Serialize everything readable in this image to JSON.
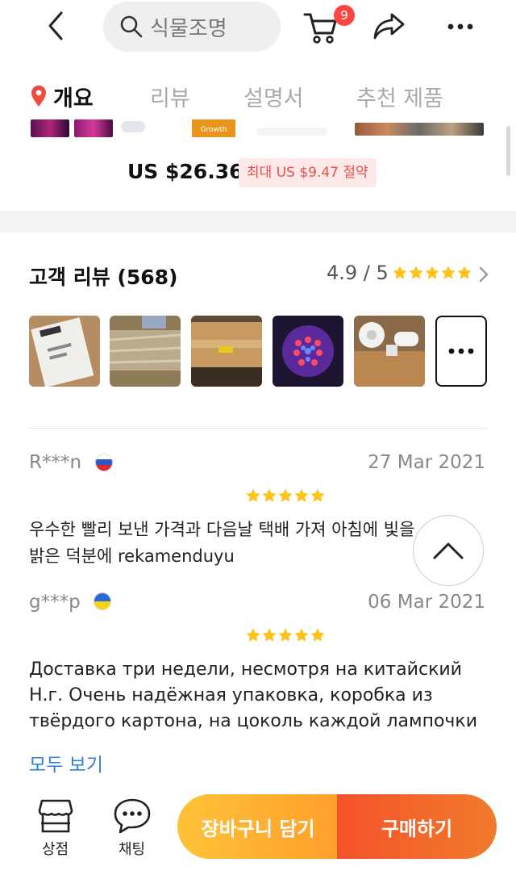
{
  "header": {
    "search_placeholder": "식물조명",
    "cart_count": "9"
  },
  "tabs": [
    {
      "label": "개요",
      "active": true
    },
    {
      "label": "리뷰"
    },
    {
      "label": "설명서"
    },
    {
      "label": "추천 제품"
    }
  ],
  "product": {
    "strip_badge": "Growth",
    "price": "US $26.36",
    "save": "최대 US $9.47 절약"
  },
  "reviews": {
    "title": "고객 리뷰 (568)",
    "score": "4.9 / 5",
    "rating_stars": 5,
    "items": [
      {
        "name": "R***n",
        "country_flag": "russia-flag",
        "date": "27 Mar 2021",
        "stars": 5,
        "text_line1": "우수한 빨리 보낸 가격과 다음날 택배 가져 아침에 빛을",
        "text_line2": "밝은 덕분에 rekamenduyu"
      },
      {
        "name": "g***p",
        "country_flag": "ukraine-flag",
        "date": "06 Mar 2021",
        "stars": 5,
        "text_line1": "Доставка три недели, несмотря на китайский",
        "text_line2": "Н.г. Очень надёжная упаковка, коробка из",
        "text_line3": "твёрдого картона, на цоколь каждой лампочки"
      }
    ],
    "see_all": "모두 보기"
  },
  "bottom_bar": {
    "store_label": "상점",
    "chat_label": "채팅",
    "add_to_cart": "장바구니 담기",
    "buy_now": "구매하기"
  },
  "colors": {
    "accent_red": "#f5532a",
    "accent_orange": "#ffc23a",
    "star": "#ffc21a",
    "link": "#2e7fd9"
  }
}
